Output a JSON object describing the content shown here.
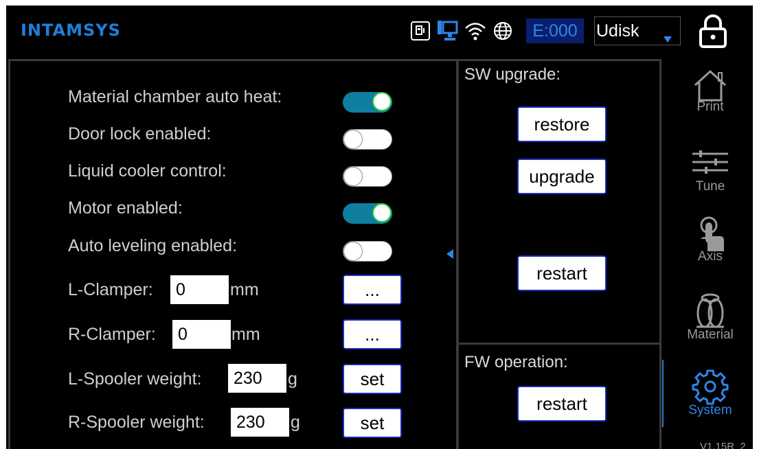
{
  "header": {
    "logo": "INTAMSYS",
    "error_code": "E:000",
    "storage": "Udisk"
  },
  "status_icons": [
    "usb-device-icon",
    "network-icon",
    "wifi-icon",
    "globe-icon"
  ],
  "settings": {
    "toggles": [
      {
        "label": "Material chamber auto heat:",
        "on": true
      },
      {
        "label": "Door lock enabled:",
        "on": false
      },
      {
        "label": "Liquid cooler control:",
        "on": false
      },
      {
        "label": "Motor enabled:",
        "on": true
      },
      {
        "label": "Auto leveling enabled:",
        "on": false
      }
    ],
    "l_clamper": {
      "label": "L-Clamper:",
      "value": "0",
      "unit": "mm",
      "button": "..."
    },
    "r_clamper": {
      "label": "R-Clamper:",
      "value": "0",
      "unit": "mm",
      "button": "..."
    },
    "l_spooler": {
      "label": "L-Spooler weight:",
      "value": "230",
      "unit": "g",
      "button": "set"
    },
    "r_spooler": {
      "label": "R-Spooler weight:",
      "value": "230",
      "unit": "g",
      "button": "set"
    }
  },
  "sw_upgrade": {
    "title": "SW upgrade:",
    "restore": "restore",
    "upgrade": "upgrade",
    "restart": "restart"
  },
  "fw_operation": {
    "title": "FW operation:",
    "restart": "restart"
  },
  "nav": {
    "items": [
      {
        "label": "Print",
        "icon": "home-icon"
      },
      {
        "label": "Tune",
        "icon": "sliders-icon"
      },
      {
        "label": "Axis",
        "icon": "hand-pointer-icon"
      },
      {
        "label": "Material",
        "icon": "filament-icon"
      },
      {
        "label": "System",
        "icon": "gear-icon",
        "active": true
      }
    ],
    "version": "V1.15R_2"
  },
  "colors": {
    "accent": "#2f86e8",
    "toggle_on": "#0f7fa0",
    "button_border": "#1a2dbf",
    "error_bg": "#0a1e6e"
  }
}
